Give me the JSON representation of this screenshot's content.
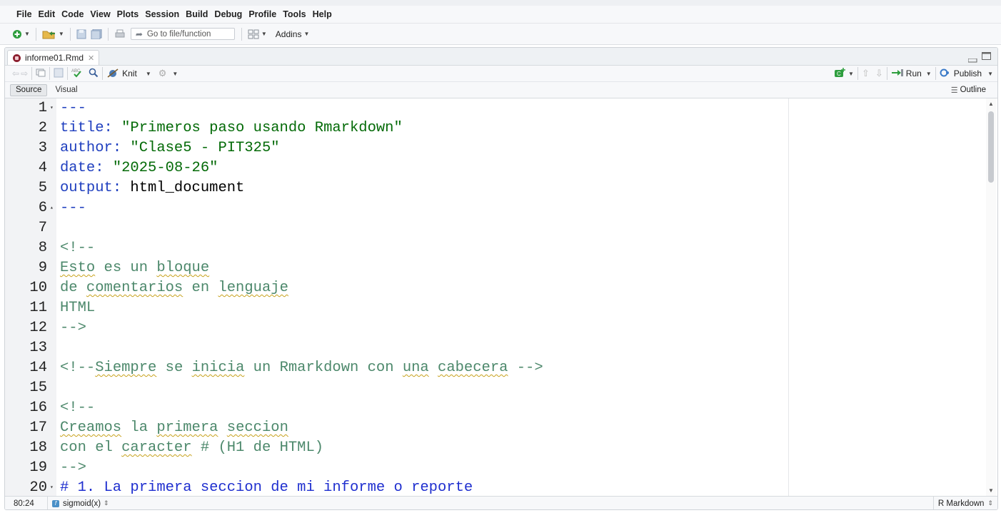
{
  "menubar": {
    "items": [
      "File",
      "Edit",
      "Code",
      "View",
      "Plots",
      "Session",
      "Build",
      "Debug",
      "Profile",
      "Tools",
      "Help"
    ]
  },
  "toolbar": {
    "goto_placeholder": "Go to file/function",
    "addins_label": "Addins"
  },
  "editor": {
    "tab_filename": "informe01.Rmd",
    "knit_label": "Knit",
    "run_label": "Run",
    "publish_label": "Publish",
    "source_label": "Source",
    "visual_label": "Visual",
    "outline_label": "Outline"
  },
  "code": {
    "lines": [
      {
        "n": "1",
        "fold": "▾",
        "tokens": [
          {
            "t": "---",
            "c": "c-key"
          }
        ]
      },
      {
        "n": "2",
        "tokens": [
          {
            "t": "title",
            "c": "c-key"
          },
          {
            "t": ": ",
            "c": "c-key"
          },
          {
            "t": "\"Primeros paso usando Rmarkdown\"",
            "c": "c-str"
          }
        ]
      },
      {
        "n": "3",
        "tokens": [
          {
            "t": "author",
            "c": "c-key"
          },
          {
            "t": ": ",
            "c": "c-key"
          },
          {
            "t": "\"Clase5 - PIT325\"",
            "c": "c-str"
          }
        ]
      },
      {
        "n": "4",
        "tokens": [
          {
            "t": "date",
            "c": "c-key"
          },
          {
            "t": ": ",
            "c": "c-key"
          },
          {
            "t": "\"2025-08-26\"",
            "c": "c-str"
          }
        ]
      },
      {
        "n": "5",
        "tokens": [
          {
            "t": "output",
            "c": "c-key"
          },
          {
            "t": ": ",
            "c": "c-key"
          },
          {
            "t": "html_document",
            "c": "c-plain"
          }
        ]
      },
      {
        "n": "6",
        "fold": "▴",
        "tokens": [
          {
            "t": "---",
            "c": "c-key"
          }
        ]
      },
      {
        "n": "7",
        "tokens": []
      },
      {
        "n": "8",
        "tokens": [
          {
            "t": "<!--",
            "c": "c-comment"
          }
        ]
      },
      {
        "n": "9",
        "tokens": [
          {
            "t": "Esto",
            "c": "c-comment sq"
          },
          {
            "t": " es un ",
            "c": "c-comment"
          },
          {
            "t": "bloque",
            "c": "c-comment sq"
          }
        ]
      },
      {
        "n": "10",
        "tokens": [
          {
            "t": "de ",
            "c": "c-comment"
          },
          {
            "t": "comentarios",
            "c": "c-comment sq"
          },
          {
            "t": " en ",
            "c": "c-comment"
          },
          {
            "t": "lenguaje",
            "c": "c-comment sq"
          }
        ]
      },
      {
        "n": "11",
        "tokens": [
          {
            "t": "HTML",
            "c": "c-comment"
          }
        ]
      },
      {
        "n": "12",
        "tokens": [
          {
            "t": "-->",
            "c": "c-comment"
          }
        ]
      },
      {
        "n": "13",
        "tokens": []
      },
      {
        "n": "14",
        "tokens": [
          {
            "t": "<!--",
            "c": "c-comment"
          },
          {
            "t": "Siempre",
            "c": "c-comment sq"
          },
          {
            "t": " se ",
            "c": "c-comment"
          },
          {
            "t": "inicia",
            "c": "c-comment sq"
          },
          {
            "t": " un Rmarkdown con ",
            "c": "c-comment"
          },
          {
            "t": "una",
            "c": "c-comment sq"
          },
          {
            "t": " ",
            "c": "c-comment"
          },
          {
            "t": "cabecera",
            "c": "c-comment sq"
          },
          {
            "t": " -->",
            "c": "c-comment"
          }
        ]
      },
      {
        "n": "15",
        "tokens": []
      },
      {
        "n": "16",
        "tokens": [
          {
            "t": "<!--",
            "c": "c-comment"
          }
        ]
      },
      {
        "n": "17",
        "tokens": [
          {
            "t": "Creamos",
            "c": "c-comment sq"
          },
          {
            "t": " la ",
            "c": "c-comment"
          },
          {
            "t": "primera",
            "c": "c-comment sq"
          },
          {
            "t": " ",
            "c": "c-comment"
          },
          {
            "t": "seccion",
            "c": "c-comment sq"
          }
        ]
      },
      {
        "n": "18",
        "tokens": [
          {
            "t": "con el ",
            "c": "c-comment"
          },
          {
            "t": "caracter",
            "c": "c-comment sq"
          },
          {
            "t": " # (H1 de HTML)",
            "c": "c-comment"
          }
        ]
      },
      {
        "n": "19",
        "tokens": [
          {
            "t": "-->",
            "c": "c-comment"
          }
        ]
      },
      {
        "n": "20",
        "fold": "▾",
        "tokens": [
          {
            "t": "# 1. La primera seccion de mi informe o reporte",
            "c": "c-header"
          }
        ]
      }
    ]
  },
  "status": {
    "position": "80:24",
    "function": "sigmoid(x)",
    "language": "R Markdown"
  },
  "colors": {
    "yaml_key": "#1f3fbf",
    "string": "#036a07",
    "comment": "#4c886b",
    "header": "#1f2fcf"
  }
}
